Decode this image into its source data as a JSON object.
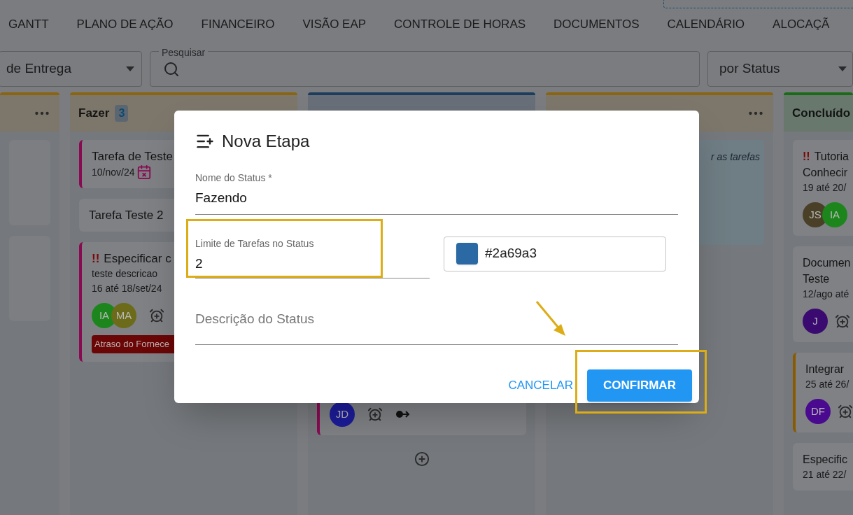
{
  "tabs": [
    {
      "label": "GANTT"
    },
    {
      "label": "PLANO DE AÇÃO"
    },
    {
      "label": "FINANCEIRO"
    },
    {
      "label": "VISÃO EAP"
    },
    {
      "label": "CONTROLE DE HORAS"
    },
    {
      "label": "DOCUMENTOS"
    },
    {
      "label": "CALENDÁRIO"
    },
    {
      "label": "ALOCAÇÃ"
    }
  ],
  "filters": {
    "delivery": {
      "value": "de Entrega"
    },
    "search": {
      "label": "Pesquisar"
    },
    "grouping": {
      "value": "por Status"
    }
  },
  "columns": [
    {
      "kind": "partial",
      "color": "#8a6410",
      "menu": true,
      "cards": [
        {
          "kind": "blank"
        },
        {
          "kind": "blank"
        }
      ]
    },
    {
      "kind": "full",
      "color": "#8a6410",
      "title": "Fazer",
      "count": "3",
      "menu": false,
      "cards": [
        {
          "kind": "task",
          "color": "#8a0a52",
          "title_lines": [
            "Tarefa de Teste"
          ],
          "date": "10/nov/24",
          "overdue": true
        },
        {
          "kind": "task",
          "title_lines": [
            "Tarefa Teste 2"
          ]
        },
        {
          "kind": "task",
          "color": "#8a0a52",
          "flag": "!!",
          "title_lines": [
            "Especificar c"
          ],
          "description": "teste descricao",
          "date": "16 até 18/set/24",
          "members": [
            {
              "initials": "IA",
              "color": "#1c861c"
            },
            {
              "initials": "MA",
              "color": "#6b6b1a"
            }
          ],
          "alarm": true,
          "tag": "Atraso do Fornece"
        }
      ]
    },
    {
      "kind": "full",
      "color": "#1e3d5c",
      "menu": false,
      "add": true,
      "cards": [
        {
          "kind": "task",
          "color": "#8a0a52",
          "members": [
            {
              "initials": "JD",
              "color": "#1c1c9a"
            }
          ],
          "alarm": true,
          "dependency": true
        }
      ]
    },
    {
      "kind": "full",
      "color": "#8a6410",
      "menu": true,
      "note": "r as tarefas"
    },
    {
      "kind": "edge",
      "color": "#1a6a1a",
      "title": "Concluído",
      "menu": false,
      "cards": [
        {
          "kind": "task",
          "flag": "!!",
          "title_lines": [
            "Tutoria",
            "Conhecir"
          ],
          "date": "19 até 20/",
          "members": [
            {
              "initials": "JS",
              "color": "#4a4028"
            },
            {
              "initials": "IA",
              "color": "#1c861c"
            }
          ]
        },
        {
          "kind": "task",
          "title_lines": [
            "Documen",
            "Teste"
          ],
          "date": "12/ago até",
          "members": [
            {
              "initials": "J",
              "color": "#3a0a70"
            }
          ],
          "alarm": true
        },
        {
          "kind": "task",
          "color": "#8a5a00",
          "title_lines": [
            "Integrar"
          ],
          "date": "25 até 26/",
          "members": [
            {
              "initials": "DF",
              "color": "#4a0a90"
            }
          ],
          "alarm": true
        },
        {
          "kind": "task",
          "title_lines": [
            "Especific"
          ],
          "date": "21 até 22/"
        }
      ]
    }
  ],
  "dialog": {
    "title": "Nova Etapa",
    "name_field": {
      "label": "Nome do Status *",
      "value": "Fazendo"
    },
    "limit_field": {
      "label": "Limite de Tarefas no Status",
      "value": "2"
    },
    "color_field": {
      "value": "#2a69a3",
      "color": "#2a69a3"
    },
    "description_field": {
      "placeholder": "Descrição do Status"
    },
    "buttons": [
      {
        "label": "CANCELAR",
        "kind": "text"
      },
      {
        "label": "CONFIRMAR",
        "kind": "contained"
      }
    ]
  }
}
